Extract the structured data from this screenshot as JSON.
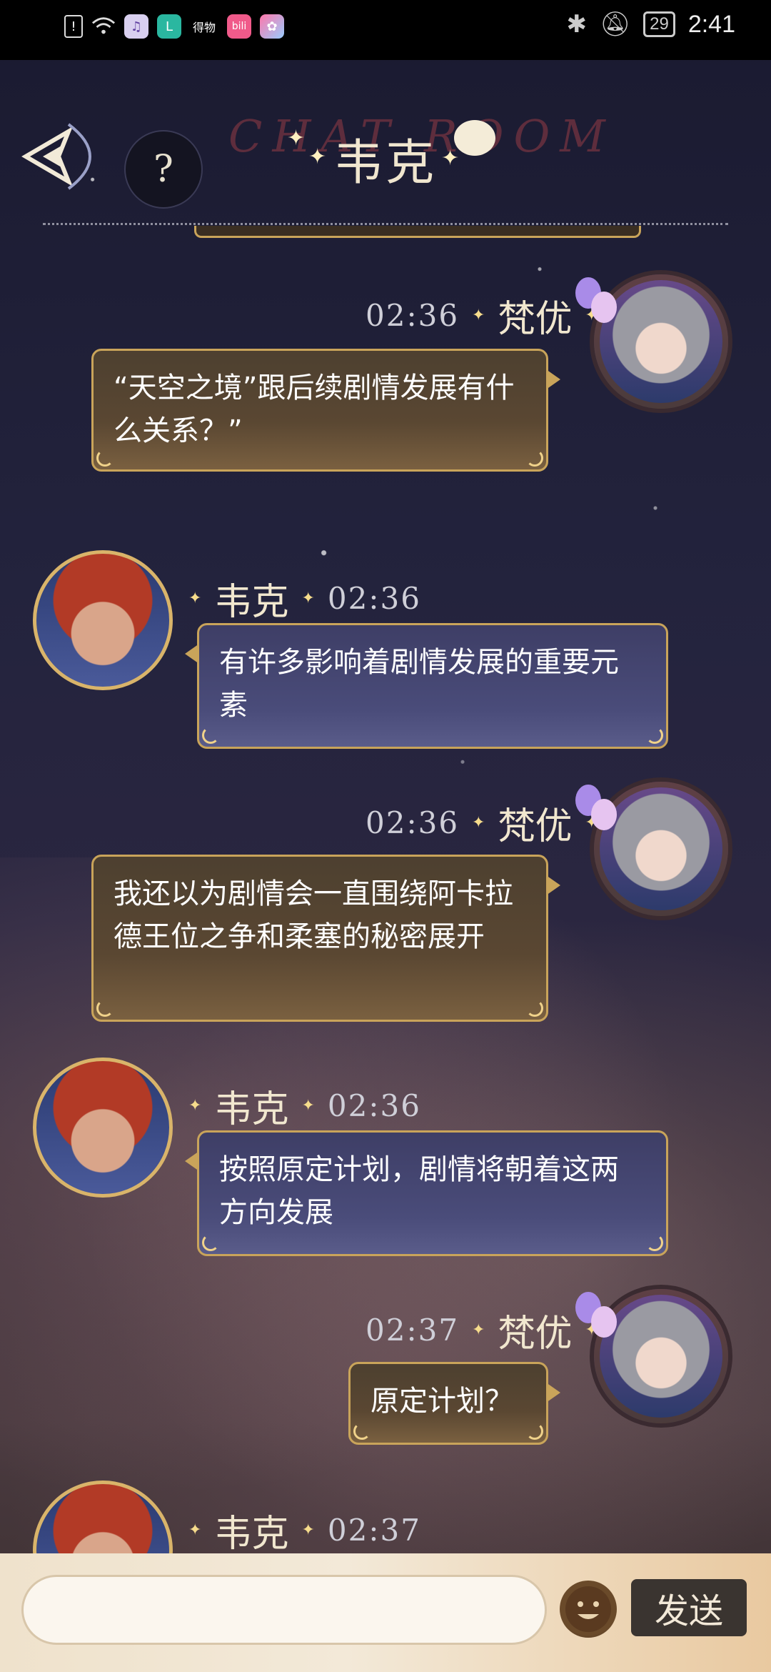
{
  "status_bar": {
    "time": "2:41",
    "battery": "29",
    "left_icons": [
      "alert-icon",
      "wifi-icon",
      "music-app-icon",
      "l-app-icon",
      "dewu-app-icon",
      "bilibili-app-icon",
      "flower-app-icon"
    ],
    "app_labels": {
      "dewu": "得物",
      "bilibili": "bili"
    }
  },
  "header": {
    "title": "韦克",
    "watermark": "CHAT ROOM",
    "help_label": "?"
  },
  "messages": [
    {
      "side": "user",
      "name": "梵优",
      "time": "02:36",
      "text": "“天空之境”跟后续剧情发展有什么关系？”"
    },
    {
      "side": "npc",
      "name": "韦克",
      "time": "02:36",
      "text": "有许多影响着剧情发展的重要元素"
    },
    {
      "side": "user",
      "name": "梵优",
      "time": "02:36",
      "text": "我还以为剧情会一直围绕阿卡拉德王位之争和柔塞的秘密展开"
    },
    {
      "side": "npc",
      "name": "韦克",
      "time": "02:36",
      "text": "按照原定计划，剧情将朝着这两方向发展"
    },
    {
      "side": "user",
      "name": "梵优",
      "time": "02:37",
      "text": "原定计划？"
    },
    {
      "side": "npc",
      "name": "韦克",
      "time": "02:37",
      "text": ""
    }
  ],
  "input": {
    "value": "",
    "placeholder": "",
    "send_label": "发送"
  },
  "colors": {
    "bubble_border": "#c9a45a",
    "user_bubble": "#5a4732",
    "npc_bubble": "#4a4c7a",
    "header_bg": "#000000"
  }
}
